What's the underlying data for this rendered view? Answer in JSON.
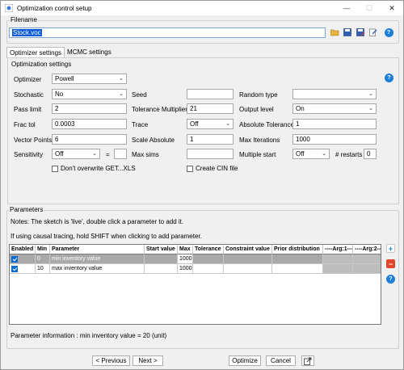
{
  "window": {
    "title": "Optimization control setup",
    "minimize": "—",
    "maximize": "☐",
    "close": "✕"
  },
  "filename": {
    "label": "Filename",
    "value": "Stock.voc",
    "toolbar": [
      "open-folder-icon",
      "save-icon",
      "save-as-icon",
      "edit-icon",
      "help-icon"
    ]
  },
  "tabs": [
    "Optimizer settings",
    "MCMC settings"
  ],
  "optimization": {
    "group_label": "Optimization settings",
    "optimizer_label": "Optimizer",
    "optimizer_value": "Powell",
    "stochastic_label": "Stochastic",
    "stochastic_value": "No",
    "seed_label": "Seed",
    "seed_value": "",
    "random_type_label": "Random type",
    "random_type_value": "",
    "pass_limit_label": "Pass limit",
    "pass_limit_value": "2",
    "tol_mult_label": "Tolerance Multiplier",
    "tol_mult_value": "21",
    "output_level_label": "Output level",
    "output_level_value": "On",
    "frac_tol_label": "Frac tol",
    "frac_tol_value": "0.0003",
    "trace_label": "Trace",
    "trace_value": "Off",
    "abs_tol_label": "Absolute Tolerance",
    "abs_tol_value": "1",
    "vector_points_label": "Vector Points",
    "vector_points_value": "6",
    "scale_abs_label": "Scale Absolute",
    "scale_abs_value": "1",
    "max_iter_label": "Max Iterations",
    "max_iter_value": "1000",
    "sensitivity_label": "Sensitivity",
    "sensitivity_value": "Off",
    "equals": "=",
    "sensitivity_eq_value": "",
    "max_sims_label": "Max sims",
    "max_sims_value": "",
    "multiple_start_label": "Multiple start",
    "multiple_start_value": "Off",
    "restarts_label": "# restarts",
    "restarts_value": "0",
    "dont_overwrite_label": "Don't overwrite GET...XLS",
    "create_cin_label": "Create CIN file"
  },
  "parameters": {
    "group_label": "Parameters",
    "note1": "Notes: The sketch is 'live', double click a parameter to add it.",
    "note2": "If using causal tracing, hold SHIFT when clicking to add parameter.",
    "columns": [
      "Enabled",
      "Min",
      "Parameter",
      "Start value",
      "Max",
      "Tolerance",
      "Constraint value",
      "Prior distribution",
      "----Arg:1----",
      "----Arg:2----"
    ],
    "rows": [
      {
        "enabled": true,
        "min": "0",
        "parameter": "min inventory value",
        "start": "",
        "max": "1000",
        "selected": true
      },
      {
        "enabled": true,
        "min": "10",
        "parameter": "max inventory value",
        "start": "",
        "max": "1000",
        "selected": false
      }
    ],
    "add": "+",
    "remove": "−",
    "help": "?",
    "info": "Parameter information : min inventory value = 20 (unit)"
  },
  "footer": {
    "previous": "< Previous",
    "next": "Next >",
    "optimize": "Optimize",
    "cancel": "Cancel"
  },
  "colors": {
    "accent": "#0a5bd3",
    "selected_row": "#a9a9a9",
    "help_blue": "#1c7fd6",
    "remove_red": "#e0452b"
  }
}
